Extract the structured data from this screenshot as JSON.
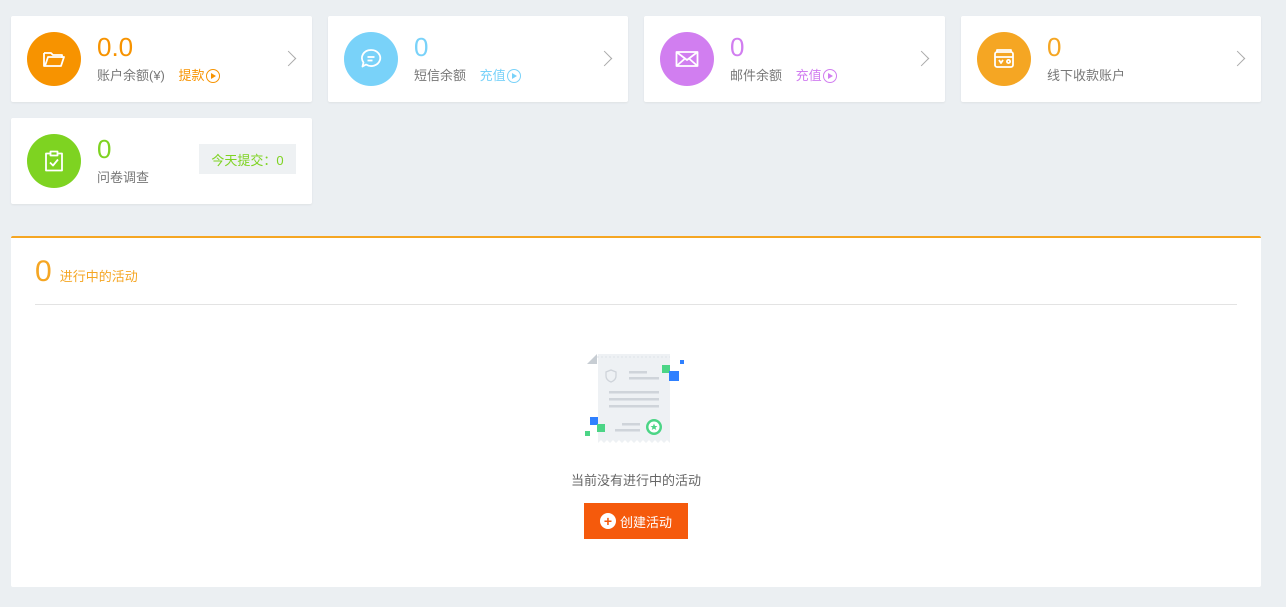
{
  "cards": [
    {
      "value": "0.0",
      "label": "账户余额(¥)",
      "link": "提款",
      "color": "#f79300",
      "icon": "folder-icon"
    },
    {
      "value": "0",
      "label": "短信余额",
      "link": "充值",
      "color": "#79d2f9",
      "icon": "chat-bubble-icon"
    },
    {
      "value": "0",
      "label": "邮件余额",
      "link": "充值",
      "color": "#d17ef0",
      "icon": "envelope-icon"
    },
    {
      "value": "0",
      "label": "线下收款账户",
      "color": "#f5a623",
      "icon": "wallet-icon"
    },
    {
      "value": "0",
      "label": "问卷调查",
      "badge": "今天提交：0",
      "color": "#7ed321",
      "icon": "clipboard-check-icon"
    }
  ],
  "activities": {
    "count": "0",
    "title": "进行中的活动",
    "empty_text": "当前没有进行中的活动",
    "create_label": "创建活动",
    "accent": "#f5a623",
    "button_color": "#f55a0c"
  }
}
